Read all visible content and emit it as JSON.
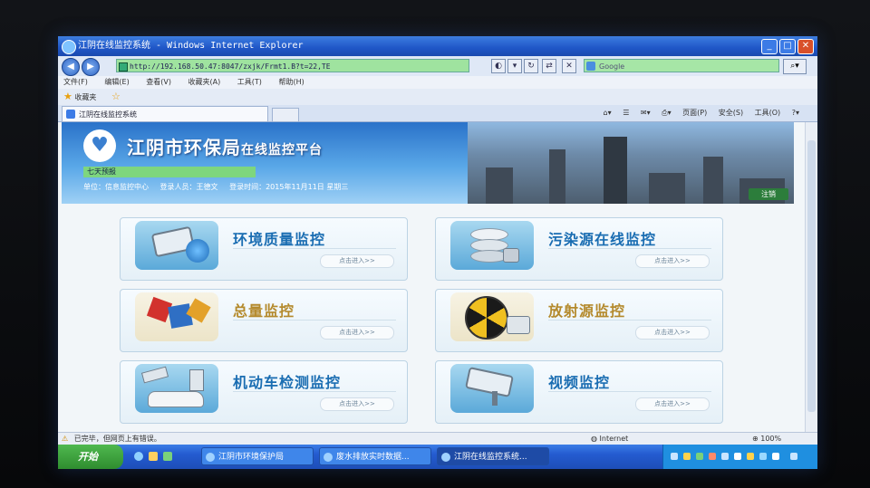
{
  "window": {
    "title": "江阴在线监控系统 - Windows Internet Explorer"
  },
  "addressbar": {
    "url": "http://192.168.50.47:8047/zxjk/Frmt1.B?t=22,TE",
    "search_placeholder": "Google"
  },
  "menu": [
    "文件(F)",
    "编辑(E)",
    "查看(V)",
    "收藏夹(A)",
    "工具(T)",
    "帮助(H)"
  ],
  "favorites": {
    "label": "收藏夹"
  },
  "tab": {
    "label": "江阴在线监控系统"
  },
  "commandbar": {
    "page": "页面(P)",
    "safety": "安全(S)",
    "tools": "工具(O)"
  },
  "banner": {
    "title_main": "江阴市环保局",
    "title_sub": "在线监控平台",
    "weather": "七天预报",
    "unit": "单位：信息监控中心",
    "user": "登录人员：王德文",
    "login_time": "登录时间：2015年11月11日 星期三",
    "logout": "注销"
  },
  "cards": [
    {
      "label": "环境质量监控",
      "go": "点击进入>>",
      "icon": "camera-globe-icon"
    },
    {
      "label": "污染源在线监控",
      "go": "点击进入>>",
      "icon": "database-icon"
    },
    {
      "label": "总量监控",
      "go": "点击进入>>",
      "icon": "cubes-icon"
    },
    {
      "label": "放射源监控",
      "go": "点击进入>>",
      "icon": "radiation-icon"
    },
    {
      "label": "机动车检测监控",
      "go": "点击进入>>",
      "icon": "car-icon"
    },
    {
      "label": "视频监控",
      "go": "点击进入>>",
      "icon": "cctv-icon"
    }
  ],
  "statusbar": {
    "text": "已完毕，但网页上有错误。",
    "zone": "Internet",
    "zoom": "100%"
  },
  "taskbar": {
    "start": "开始",
    "tasks": [
      "江阴市环境保护局",
      "废水排放实时数据...",
      "江阴在线监控系统..."
    ]
  }
}
